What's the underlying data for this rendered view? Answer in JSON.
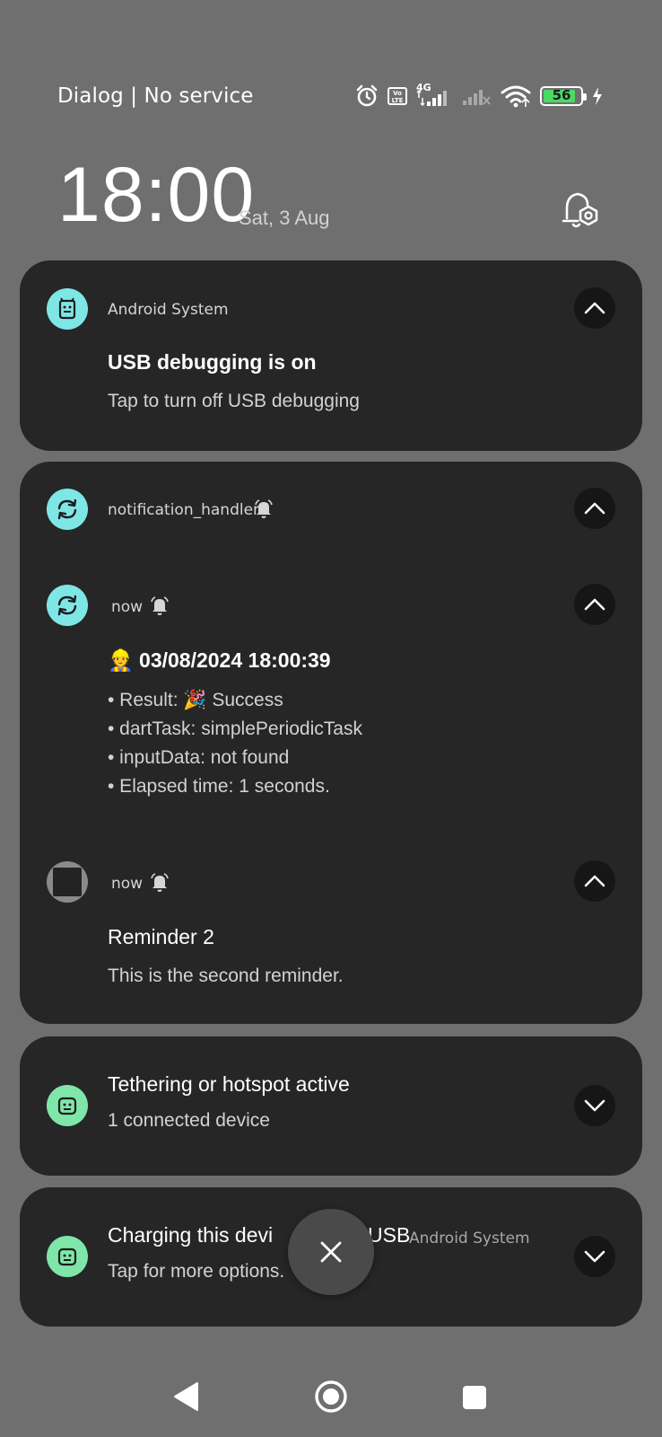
{
  "status_bar": {
    "carrier": "Dialog | No service",
    "network_label": "4G",
    "volte_label": "Vo LTE",
    "battery": "56",
    "icons": [
      "alarm-icon",
      "volte-icon",
      "signal-4g-icon",
      "signal-no-service-icon",
      "wifi-icon",
      "battery-icon",
      "charging-bolt-icon"
    ]
  },
  "lockscreen": {
    "time": "18:00",
    "date": "Sat, 3 Aug"
  },
  "notifications": [
    {
      "app": "Android System",
      "title": "USB debugging is on",
      "body": "Tap to turn off USB debugging",
      "icon": "android-system-icon"
    },
    {
      "group_app": "notification_handler",
      "items": [
        {
          "time": "now",
          "title": "👷 03/08/2024 18:00:39",
          "lines": [
            "• Result: 🎉 Success",
            "• dartTask: simplePeriodicTask",
            "• inputData: not found",
            "• Elapsed time: 1 seconds."
          ]
        },
        {
          "time": "now",
          "title": "Reminder 2",
          "body": "This is the second reminder."
        }
      ]
    },
    {
      "title": "Tethering or hotspot active",
      "body": "1 connected device",
      "icon": "android-robot-icon"
    },
    {
      "title": "Charging this device via USB",
      "title_visible": "Charging this devi",
      "title_tail_visible": "USB",
      "app": "Android System",
      "body": "Tap for more options.",
      "icon": "android-robot-icon"
    }
  ],
  "colors": {
    "background": "#6f6f6f",
    "card": "#262626",
    "icon_cyan": "#7fe6e6",
    "icon_green": "#7fe6a9",
    "battery_green": "#4cd964"
  }
}
